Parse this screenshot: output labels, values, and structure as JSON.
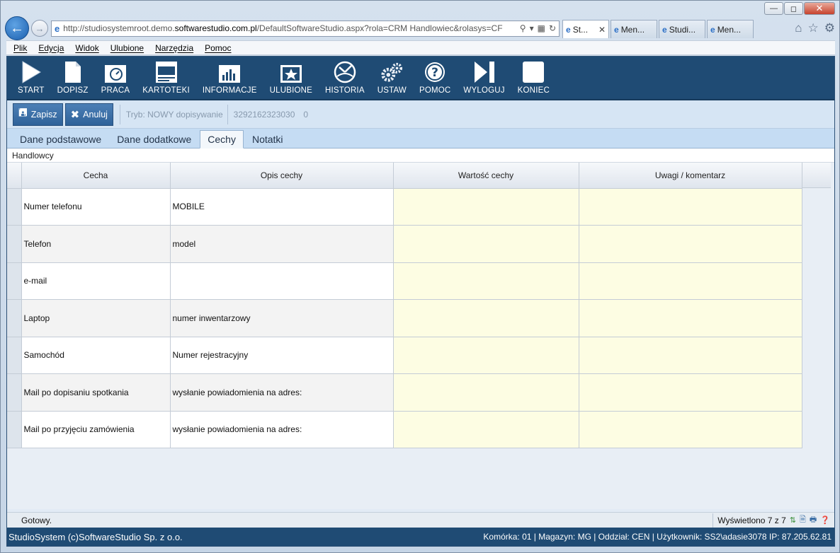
{
  "browser": {
    "address": {
      "prefix": "http://studiosystemroot.demo.",
      "host": "softwarestudio.com.pl",
      "path": "/DefaultSoftwareStudio.aspx?rola=CRM Handlowiec&rolasys=CF"
    },
    "tabs": [
      {
        "label": "St...",
        "active": true
      },
      {
        "label": "Men...",
        "active": false
      },
      {
        "label": "Studi...",
        "active": false
      },
      {
        "label": "Men...",
        "active": false
      }
    ],
    "menu": [
      "Plik",
      "Edycja",
      "Widok",
      "Ulubione",
      "Narzędzia",
      "Pomoc"
    ]
  },
  "toolbar": {
    "items": [
      {
        "label": "START",
        "icon": "play-icon"
      },
      {
        "label": "DOPISZ",
        "icon": "document-icon"
      },
      {
        "label": "PRACA",
        "icon": "work-icon"
      },
      {
        "label": "KARTOTEKI",
        "icon": "window-icon"
      },
      {
        "label": "INFORMACJE",
        "icon": "chart-icon"
      },
      {
        "label": "ULUBIONE",
        "icon": "star-icon"
      },
      {
        "label": "HISTORIA",
        "icon": "history-icon"
      },
      {
        "label": "USTAW",
        "icon": "gears-icon"
      },
      {
        "label": "POMOC",
        "icon": "help-icon"
      },
      {
        "label": "WYLOGUJ",
        "icon": "logout-icon"
      },
      {
        "label": "KONIEC",
        "icon": "stop-icon"
      }
    ]
  },
  "actions": {
    "save_label": "Zapisz",
    "cancel_label": "Anuluj",
    "mode": "Tryb: NOWY dopisywanie",
    "record_id": "3292162323030",
    "record_num": "0"
  },
  "page_tabs": [
    {
      "label": "Dane podstawowe",
      "active": false
    },
    {
      "label": "Dane dodatkowe",
      "active": false
    },
    {
      "label": "Cechy",
      "active": true
    },
    {
      "label": "Notatki",
      "active": false
    }
  ],
  "section": "Handlowcy",
  "grid": {
    "columns": [
      "Cecha",
      "Opis cechy",
      "Wartość cechy",
      "Uwagi / komentarz"
    ],
    "rows": [
      {
        "cecha": "Numer telefonu",
        "opis": "MOBILE",
        "wartosc": "",
        "uwagi": ""
      },
      {
        "cecha": "Telefon",
        "opis": "model",
        "wartosc": "",
        "uwagi": ""
      },
      {
        "cecha": "e-mail",
        "opis": "",
        "wartosc": "",
        "uwagi": ""
      },
      {
        "cecha": "Laptop",
        "opis": "numer inwentarzowy",
        "wartosc": "",
        "uwagi": ""
      },
      {
        "cecha": "Samochód",
        "opis": "Numer rejestracyjny",
        "wartosc": "",
        "uwagi": ""
      },
      {
        "cecha": "Mail po dopisaniu spotkania",
        "opis": "wysłanie powiadomienia na adres:",
        "wartosc": "",
        "uwagi": ""
      },
      {
        "cecha": "Mail po przyjęciu zamówienia",
        "opis": "wysłanie powiadomienia na adres:",
        "wartosc": "",
        "uwagi": ""
      }
    ]
  },
  "status": {
    "ready": "Gotowy.",
    "count": "Wyświetlono 7 z 7"
  },
  "footer": {
    "copyright": "StudioSystem (c)SoftwareStudio Sp. z o.o.",
    "info": "Komórka: 01 | Magazyn: MG | Oddział: CEN | Użytkownik: SS2\\adasie3078 IP: 87.205.62.81"
  }
}
